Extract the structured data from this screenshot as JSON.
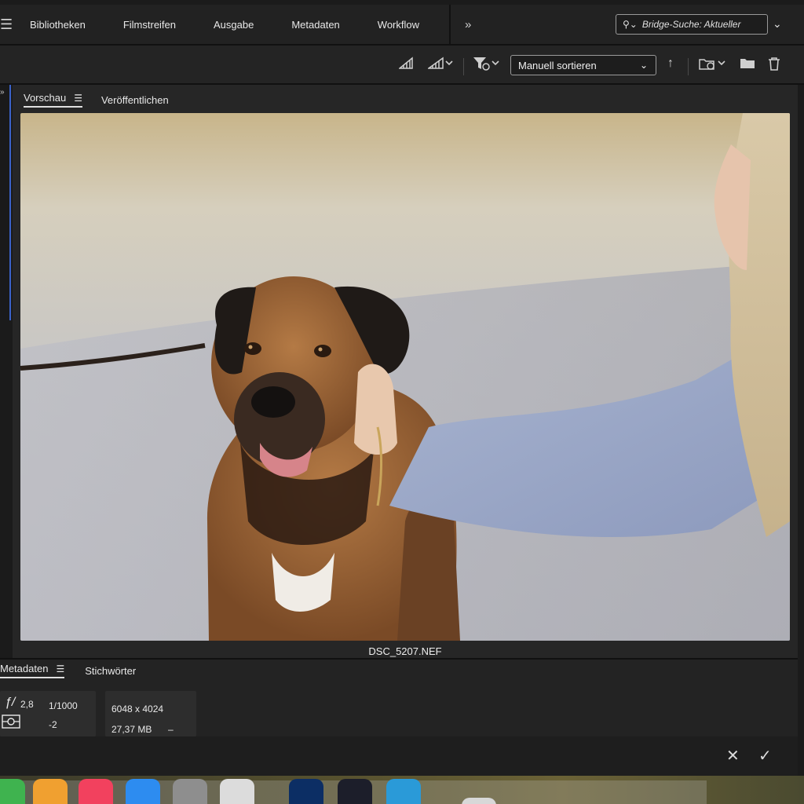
{
  "workspace_tabs": [
    "Bibliotheken",
    "Filmstreifen",
    "Ausgabe",
    "Metadaten",
    "Workflow"
  ],
  "search": {
    "placeholder": "Bridge-Suche: Aktueller"
  },
  "toolbar": {
    "sort_label": "Manuell sortieren"
  },
  "panel": {
    "tabs": [
      {
        "label": "Vorschau"
      },
      {
        "label": "Veröffentlichen"
      }
    ],
    "filename": "DSC_5207.NEF"
  },
  "metadata": {
    "tabs": [
      {
        "label": "Metadaten"
      },
      {
        "label": "Stichwörter"
      }
    ],
    "aperture": "2,8",
    "aperture_prefix": "ƒ/",
    "shutter": "1/1000",
    "exposure_comp": "-2",
    "dimensions": "6048 x 4024",
    "filesize": "27,37 MB",
    "dash": "–"
  },
  "colors": {
    "accent_blue": "#3a62c9",
    "panel_bg": "#262626",
    "bar_bg": "#222222"
  },
  "icons": {
    "workspace_menu": "menu-icon",
    "more": "double-chevron-right-icon",
    "search": "search-icon",
    "star_filter": "rating-icon",
    "filter": "filter-icon",
    "sort_dir": "arrow-up-icon",
    "recent": "recent-folder-icon",
    "new_folder": "folder-icon",
    "delete": "trash-icon",
    "cancel": "close-icon",
    "apply": "check-icon"
  }
}
